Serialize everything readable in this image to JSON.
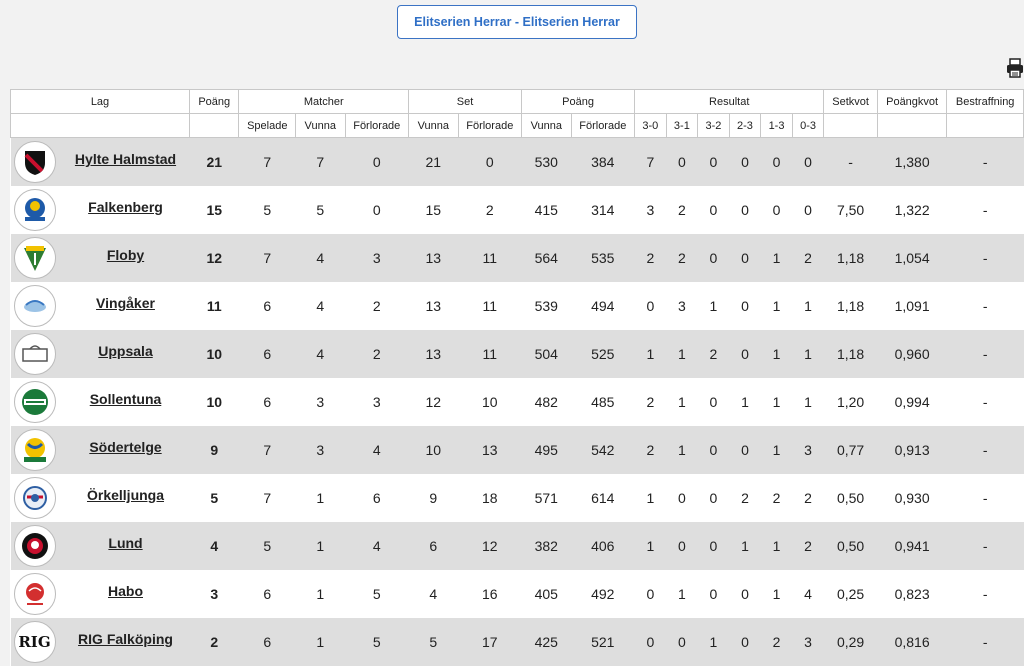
{
  "competition_button": "Elitserien Herrar - Elitserien Herrar",
  "header": {
    "lag": "Lag",
    "poang": "Poäng",
    "matcher": "Matcher",
    "set": "Set",
    "poang_group": "Poäng",
    "resultat": "Resultat",
    "setkvot": "Setkvot",
    "poangkvot": "Poängkvot",
    "bestraffning": "Bestraffning",
    "spelade": "Spelade",
    "vunna": "Vunna",
    "forlorade": "Förlorade",
    "r30": "3-0",
    "r31": "3-1",
    "r32": "3-2",
    "r23": "2-3",
    "r13": "1-3",
    "r03": "0-3"
  },
  "teams": [
    {
      "name": "Hylte Halmstad",
      "logo": "hylte-halmstad-logo",
      "points": "21",
      "played": "7",
      "won": "7",
      "lost": "0",
      "sets_won": "21",
      "sets_lost": "0",
      "pts_won": "530",
      "pts_lost": "384",
      "r30": "7",
      "r31": "0",
      "r32": "0",
      "r23": "0",
      "r13": "0",
      "r03": "0",
      "setkvot": "-",
      "poangkvot": "1,380",
      "penalty": "-"
    },
    {
      "name": "Falkenberg",
      "logo": "falkenberg-logo",
      "points": "15",
      "played": "5",
      "won": "5",
      "lost": "0",
      "sets_won": "15",
      "sets_lost": "2",
      "pts_won": "415",
      "pts_lost": "314",
      "r30": "3",
      "r31": "2",
      "r32": "0",
      "r23": "0",
      "r13": "0",
      "r03": "0",
      "setkvot": "7,50",
      "poangkvot": "1,322",
      "penalty": "-"
    },
    {
      "name": "Floby",
      "logo": "floby-logo",
      "points": "12",
      "played": "7",
      "won": "4",
      "lost": "3",
      "sets_won": "13",
      "sets_lost": "11",
      "pts_won": "564",
      "pts_lost": "535",
      "r30": "2",
      "r31": "2",
      "r32": "0",
      "r23": "0",
      "r13": "1",
      "r03": "2",
      "setkvot": "1,18",
      "poangkvot": "1,054",
      "penalty": "-"
    },
    {
      "name": "Vingåker",
      "logo": "vingaker-logo",
      "points": "11",
      "played": "6",
      "won": "4",
      "lost": "2",
      "sets_won": "13",
      "sets_lost": "11",
      "pts_won": "539",
      "pts_lost": "494",
      "r30": "0",
      "r31": "3",
      "r32": "1",
      "r23": "0",
      "r13": "1",
      "r03": "1",
      "setkvot": "1,18",
      "poangkvot": "1,091",
      "penalty": "-"
    },
    {
      "name": "Uppsala",
      "logo": "uppsala-logo",
      "points": "10",
      "played": "6",
      "won": "4",
      "lost": "2",
      "sets_won": "13",
      "sets_lost": "11",
      "pts_won": "504",
      "pts_lost": "525",
      "r30": "1",
      "r31": "1",
      "r32": "2",
      "r23": "0",
      "r13": "1",
      "r03": "1",
      "setkvot": "1,18",
      "poangkvot": "0,960",
      "penalty": "-"
    },
    {
      "name": "Sollentuna",
      "logo": "sollentuna-logo",
      "points": "10",
      "played": "6",
      "won": "3",
      "lost": "3",
      "sets_won": "12",
      "sets_lost": "10",
      "pts_won": "482",
      "pts_lost": "485",
      "r30": "2",
      "r31": "1",
      "r32": "0",
      "r23": "1",
      "r13": "1",
      "r03": "1",
      "setkvot": "1,20",
      "poangkvot": "0,994",
      "penalty": "-"
    },
    {
      "name": "Södertelge",
      "logo": "sodertelge-logo",
      "points": "9",
      "played": "7",
      "won": "3",
      "lost": "4",
      "sets_won": "10",
      "sets_lost": "13",
      "pts_won": "495",
      "pts_lost": "542",
      "r30": "2",
      "r31": "1",
      "r32": "0",
      "r23": "0",
      "r13": "1",
      "r03": "3",
      "setkvot": "0,77",
      "poangkvot": "0,913",
      "penalty": "-"
    },
    {
      "name": "Örkelljunga",
      "logo": "orkelljunga-logo",
      "points": "5",
      "played": "7",
      "won": "1",
      "lost": "6",
      "sets_won": "9",
      "sets_lost": "18",
      "pts_won": "571",
      "pts_lost": "614",
      "r30": "1",
      "r31": "0",
      "r32": "0",
      "r23": "2",
      "r13": "2",
      "r03": "2",
      "setkvot": "0,50",
      "poangkvot": "0,930",
      "penalty": "-"
    },
    {
      "name": "Lund",
      "logo": "lund-logo",
      "points": "4",
      "played": "5",
      "won": "1",
      "lost": "4",
      "sets_won": "6",
      "sets_lost": "12",
      "pts_won": "382",
      "pts_lost": "406",
      "r30": "1",
      "r31": "0",
      "r32": "0",
      "r23": "1",
      "r13": "1",
      "r03": "2",
      "setkvot": "0,50",
      "poangkvot": "0,941",
      "penalty": "-"
    },
    {
      "name": "Habo",
      "logo": "habo-logo",
      "points": "3",
      "played": "6",
      "won": "1",
      "lost": "5",
      "sets_won": "4",
      "sets_lost": "16",
      "pts_won": "405",
      "pts_lost": "492",
      "r30": "0",
      "r31": "1",
      "r32": "0",
      "r23": "0",
      "r13": "1",
      "r03": "4",
      "setkvot": "0,25",
      "poangkvot": "0,823",
      "penalty": "-"
    },
    {
      "name": "RIG Falköping",
      "logo": "rig-falkoping-logo",
      "logo_text": "RIG",
      "points": "2",
      "played": "6",
      "won": "1",
      "lost": "5",
      "sets_won": "5",
      "sets_lost": "17",
      "pts_won": "425",
      "pts_lost": "521",
      "r30": "0",
      "r31": "0",
      "r32": "1",
      "r23": "0",
      "r13": "2",
      "r03": "3",
      "setkvot": "0,29",
      "poangkvot": "0,816",
      "penalty": "-"
    }
  ]
}
